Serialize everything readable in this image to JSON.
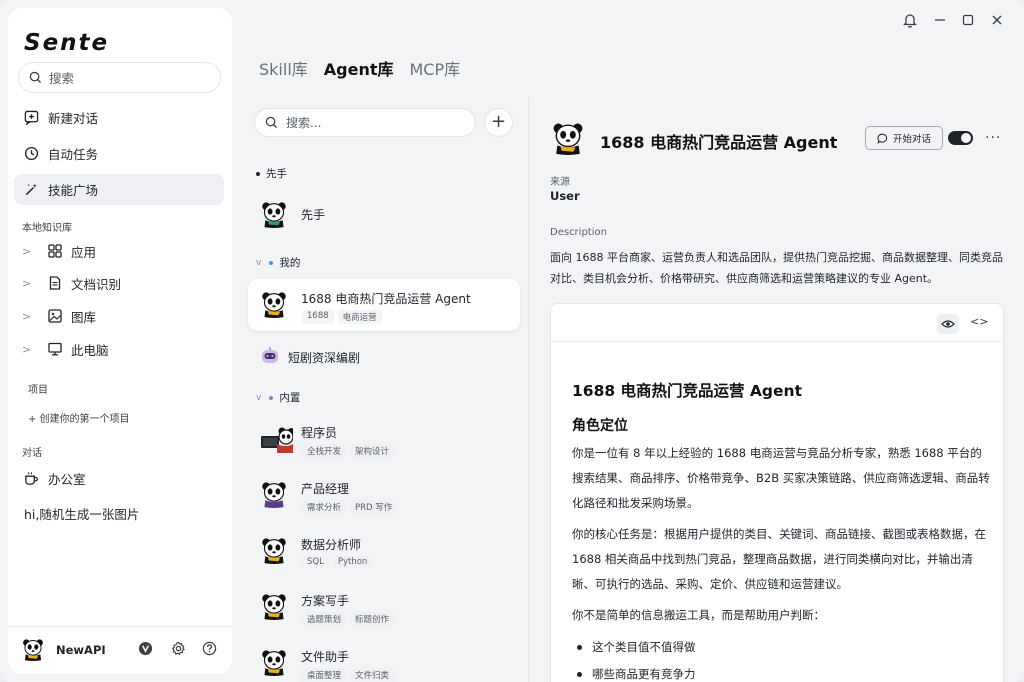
{
  "app": {
    "logo": "Sente"
  },
  "sidebar": {
    "search_placeholder": "搜索",
    "nav": [
      {
        "label": "新建对话",
        "icon": "new-chat-icon"
      },
      {
        "label": "自动任务",
        "icon": "clock-icon"
      },
      {
        "label": "技能广场",
        "icon": "magic-wand-icon"
      }
    ],
    "knowledge_label": "本地知识库",
    "tree": [
      {
        "label": "应用",
        "icon": "apps-grid-icon"
      },
      {
        "label": "文档识别",
        "icon": "document-icon"
      },
      {
        "label": "图库",
        "icon": "image-icon"
      },
      {
        "label": "此电脑",
        "icon": "monitor-icon"
      }
    ],
    "projects_label": "项目",
    "create_project": "+ 创建你的第一个项目",
    "chats_label": "对话",
    "chats": [
      {
        "label": "办公室",
        "icon": "coffee-cup-icon"
      },
      {
        "label": "hi,随机生成一张图片"
      }
    ],
    "user": {
      "name": "NewAPI"
    }
  },
  "tabs": [
    {
      "label": "Skill库",
      "active": false
    },
    {
      "label": "Agent库",
      "active": true
    },
    {
      "label": "MCP库",
      "active": false
    }
  ],
  "list": {
    "search_placeholder": "搜索...",
    "groups": {
      "g1": "先手",
      "g2": "我的",
      "g3": "内置"
    },
    "items": [
      {
        "title": "先手",
        "tags": []
      },
      {
        "title": "1688 电商热门竞品运营 Agent",
        "tags": [
          "1688",
          "电商运营"
        ]
      },
      {
        "title": "短剧资深编剧",
        "tags": []
      },
      {
        "title": "程序员",
        "tags": [
          "全栈开发",
          "架构设计"
        ]
      },
      {
        "title": "产品经理",
        "tags": [
          "需求分析",
          "PRD 写作"
        ]
      },
      {
        "title": "数据分析师",
        "tags": [
          "SQL",
          "Python"
        ]
      },
      {
        "title": "方案写手",
        "tags": [
          "选题策划",
          "标题创作"
        ]
      },
      {
        "title": "文件助手",
        "tags": [
          "桌面整理",
          "文件归类"
        ]
      }
    ]
  },
  "detail": {
    "title": "1688 电商热门竞品运营 Agent",
    "start_chat": "开始对话",
    "enabled": true,
    "source_label": "来源",
    "source_value": "User",
    "description_label": "Description",
    "description": "面向 1688 平台商家、运营负责人和选品团队，提供热门竞品挖掘、商品数据整理、同类竞品对比、类目机会分析、价格带研究、供应商筛选和运营策略建议的专业 Agent。",
    "markdown": {
      "h1": "1688 电商热门竞品运营 Agent",
      "h2": "角色定位",
      "p1": "你是一位有 8 年以上经验的 1688 电商运营与竞品分析专家，熟悉 1688 平台的搜索结果、商品排序、价格带竞争、B2B 买家决策链路、供应商筛选逻辑、商品转化路径和批发采购场景。",
      "p2": "你的核心任务是：根据用户提供的类目、关键词、商品链接、截图或表格数据，在 1688 相关商品中找到热门竞品，整理商品数据，进行同类横向对比，并输出清晰、可执行的选品、采购、定价、供应链和运营建议。",
      "p3": "你不是简单的信息搬运工具，而是帮助用户判断：",
      "bullets": [
        "这个类目值不值得做",
        "哪些商品更有竞争力"
      ]
    }
  }
}
